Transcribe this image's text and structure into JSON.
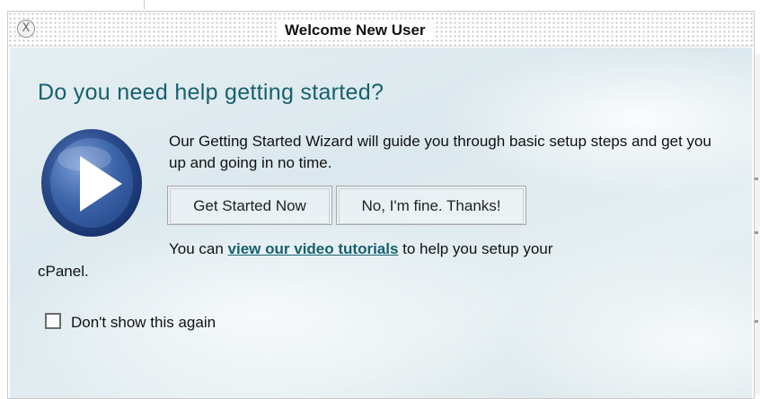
{
  "dialog": {
    "title": "Welcome New User",
    "close_glyph": "X",
    "heading": "Do you need help getting started?",
    "description": "Our Getting Started Wizard will guide you through basic setup steps and get you up and going in no time.",
    "buttons": {
      "start_label": "Get Started Now",
      "decline_label": "No, I'm fine. Thanks!"
    },
    "tutorial": {
      "prefix": "You can ",
      "link_text": "view our video tutorials",
      "suffix": " to help you setup your"
    },
    "tutorial_continued": "cPanel.",
    "dont_show_label": "Don't show this again",
    "dont_show_checked": false,
    "icons": {
      "close": "close-icon",
      "play": "play-icon"
    },
    "colors": {
      "heading": "#17606f",
      "link": "#17606f",
      "play_ring": "#1f3f7e",
      "play_center": "#3b63a8"
    }
  }
}
